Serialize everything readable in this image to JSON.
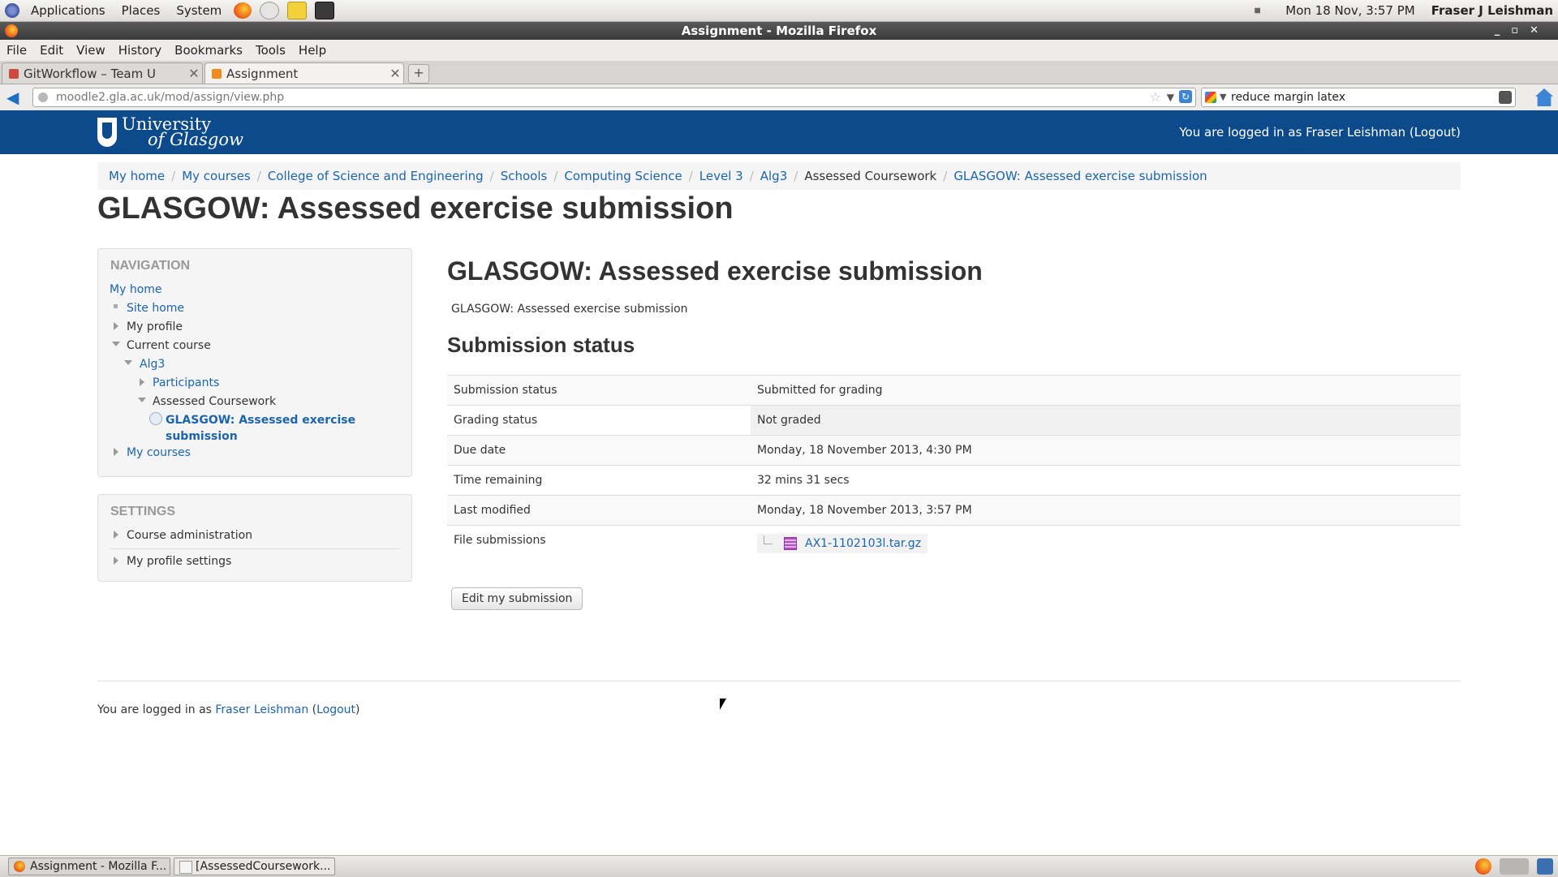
{
  "gnome_panel": {
    "menus": [
      "Applications",
      "Places",
      "System"
    ],
    "clock": "Mon 18 Nov,  3:57 PM",
    "user": "Fraser J Leishman"
  },
  "window": {
    "title": "Assignment - Mozilla Firefox"
  },
  "menubar": [
    "File",
    "Edit",
    "View",
    "History",
    "Bookmarks",
    "Tools",
    "Help"
  ],
  "tabs": [
    {
      "label": "GitWorkflow – Team U"
    },
    {
      "label": "Assignment"
    }
  ],
  "navbar": {
    "url": "moodle2.gla.ac.uk/mod/assign/view.php",
    "search": "reduce margin latex"
  },
  "site": {
    "logo_line1": "University",
    "logo_line2": "of Glasgow",
    "header_login": "You are logged in as Fraser Leishman (Logout)"
  },
  "breadcrumb": [
    "My home",
    "My courses",
    "College of Science and Engineering",
    "Schools",
    "Computing Science",
    "Level 3",
    "Alg3",
    "Assessed Coursework",
    "GLASGOW: Assessed exercise submission"
  ],
  "page_title": "GLASGOW: Assessed exercise submission",
  "navigation": {
    "title": "NAVIGATION",
    "my_home": "My home",
    "site_home": "Site home",
    "my_profile": "My profile",
    "current_course": "Current course",
    "alg3": "Alg3",
    "participants": "Participants",
    "assessed_coursework": "Assessed Coursework",
    "assignment_line1": "GLASGOW: Assessed exercise",
    "assignment_line2": "submission",
    "my_courses": "My courses"
  },
  "settings": {
    "title": "SETTINGS",
    "course_admin": "Course administration",
    "profile_settings": "My profile settings"
  },
  "main": {
    "heading": "GLASGOW: Assessed exercise submission",
    "intro": "GLASGOW: Assessed exercise submission",
    "status_heading": "Submission status",
    "rows": [
      {
        "label": "Submission status",
        "value": "Submitted for grading"
      },
      {
        "label": "Grading status",
        "value": "Not graded"
      },
      {
        "label": "Due date",
        "value": "Monday, 18 November 2013, 4:30 PM"
      },
      {
        "label": "Time remaining",
        "value": "32 mins 31 secs"
      },
      {
        "label": "Last modified",
        "value": "Monday, 18 November 2013, 3:57 PM"
      }
    ],
    "file_label": "File submissions",
    "file_name": "AX1-1102103l.tar.gz",
    "edit_button": "Edit my submission"
  },
  "footer": {
    "prefix": "You are logged in as ",
    "user": "Fraser Leishman",
    "open": " (",
    "logout": "Logout",
    "close": ")"
  },
  "taskbar": [
    {
      "label": "Assignment - Mozilla F..."
    },
    {
      "label": "[AssessedCoursework..."
    }
  ],
  "colors": {
    "header_blue": "#0c4a8c",
    "link_blue": "#1a64b0"
  }
}
